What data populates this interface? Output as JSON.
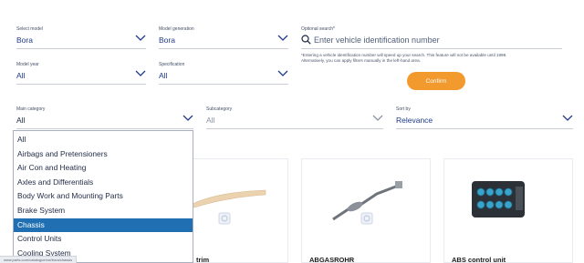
{
  "filters": {
    "model": {
      "label": "Select model",
      "value": "Bora"
    },
    "generation": {
      "label": "Model generation",
      "value": "Bora"
    },
    "search": {
      "label": "Optional search*",
      "placeholder": "Enter vehicle identification number"
    },
    "year": {
      "label": "Model year",
      "value": "All"
    },
    "specification": {
      "label": "Specification",
      "value": "All"
    },
    "note_line1": "*Entering a vehicle identification number will speed up your search. This feature will not be available until 1998.",
    "note_line2": "Alternatively, you can apply filters manually in the left-hand area.",
    "confirm_label": "Confirm",
    "main_category": {
      "label": "Main category",
      "value": "All"
    },
    "subcategory": {
      "label": "Subcategory",
      "value": "All"
    },
    "sort": {
      "label": "Sort by",
      "value": "Relevance"
    }
  },
  "dropdown": {
    "options": [
      "All",
      "Airbags and Pretensioners",
      "Air Con and Heating",
      "Axles and Differentials",
      "Body Work and Mounting Parts",
      "Brake System",
      "Chassis",
      "Control Units",
      "Cooling System"
    ],
    "selected": "Chassis"
  },
  "products": [
    {
      "name": "trim"
    },
    {
      "name": "ABGASROHR"
    },
    {
      "name": "ABS control unit"
    }
  ],
  "status_url": "www.parts.com/catalogue/vw/bora/chassis",
  "colors": {
    "accent": "#1f3a8a",
    "confirm": "#f29a2e",
    "selected": "#1f6fb2"
  }
}
